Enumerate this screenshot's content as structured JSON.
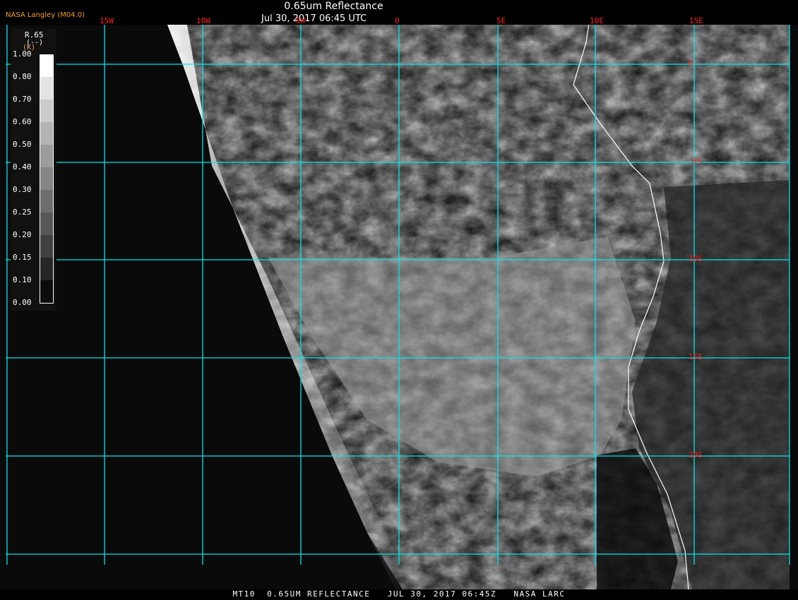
{
  "header": {
    "title": "0.65um Reflectance",
    "datetime": "Jul 30, 2017 06:45 UTC",
    "organization": "NASA Langley (M04.0)"
  },
  "longitude_labels": [
    "15W",
    "10W",
    "5W",
    "0",
    "5E",
    "10E",
    "15E"
  ],
  "latitude_labels": [
    "0",
    "5S",
    "10S",
    "15S",
    "20S"
  ],
  "colorbar": {
    "variable": "R.65",
    "units": "(--)",
    "units_alt": "(K)",
    "ticks": [
      "1.00",
      "0.80",
      "0.70",
      "0.60",
      "0.50",
      "0.40",
      "0.30",
      "0.25",
      "0.20",
      "0.15",
      "0.10",
      "0.00"
    ]
  },
  "footer": "MT10  0.65UM REFLECTANCE   JUL 30, 2017 06:45Z   NASA LARC",
  "colors": {
    "gridline": "#00e5ee",
    "grid_label": "#ff2020",
    "org_label": "#f0a020",
    "ocean": "#0a0a0a"
  }
}
